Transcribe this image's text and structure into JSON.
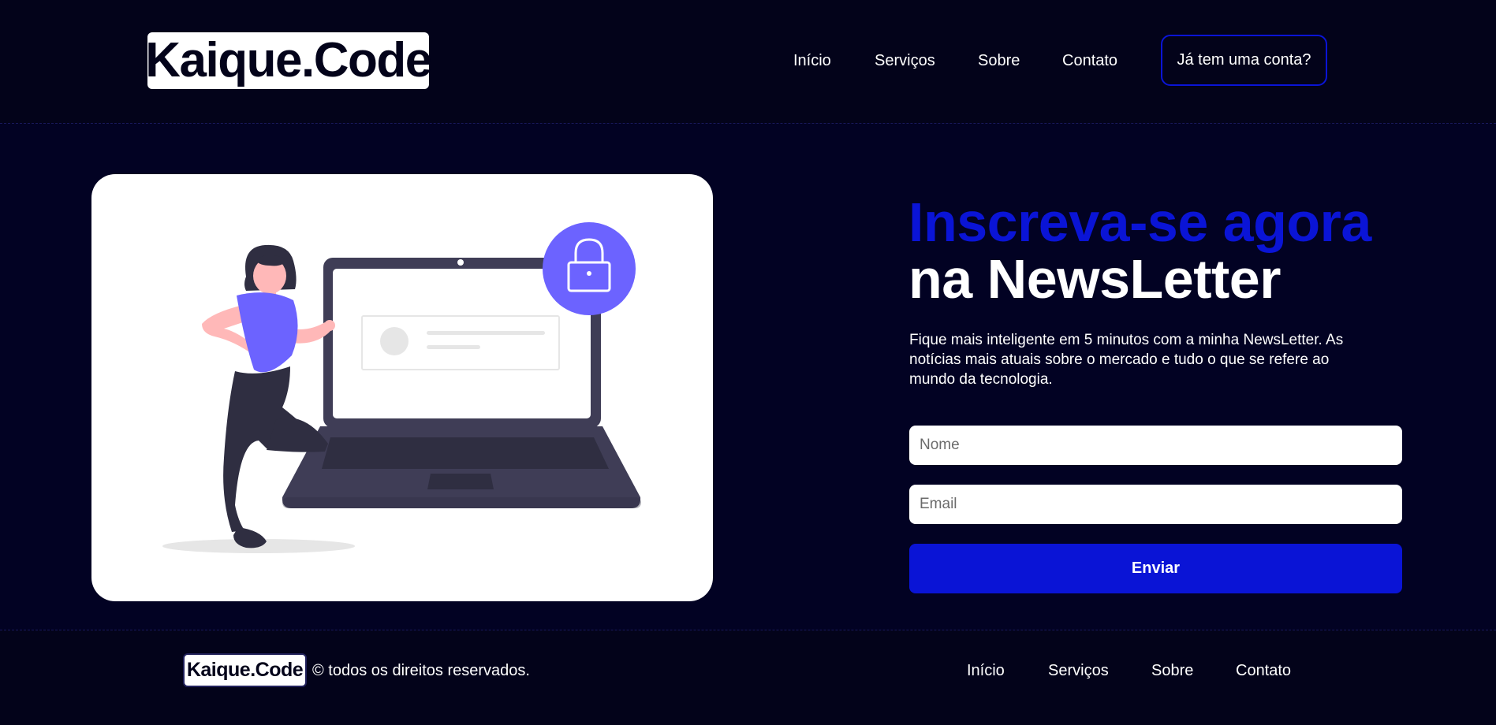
{
  "brand": {
    "name": "Kaique.Code"
  },
  "nav": {
    "items": [
      {
        "label": "Início"
      },
      {
        "label": "Serviços"
      },
      {
        "label": "Sobre"
      },
      {
        "label": "Contato"
      }
    ],
    "login_label": "Já tem uma conta?"
  },
  "hero": {
    "headline_accent": "Inscreva-se agora",
    "headline_main": "na NewsLetter",
    "description": "Fique mais inteligente em 5 minutos com a minha NewsLetter. As notícias mais atuais sobre o mercado e tudo o que se refere ao mundo da tecnologia."
  },
  "form": {
    "name_placeholder": "Nome",
    "email_placeholder": "Email",
    "submit_label": "Enviar"
  },
  "footer": {
    "brand": "Kaique.Code",
    "copyright": "© todos os direitos reservados.",
    "nav": [
      {
        "label": "Início"
      },
      {
        "label": "Serviços"
      },
      {
        "label": "Sobre"
      },
      {
        "label": "Contato"
      }
    ]
  },
  "colors": {
    "background": "#020223",
    "accent": "#0a14d6",
    "illustration_purple": "#6c63ff",
    "illustration_dark": "#3f3d56"
  },
  "icons": {
    "lock": "lock-icon",
    "illustration": "woman-with-laptop-illustration"
  }
}
